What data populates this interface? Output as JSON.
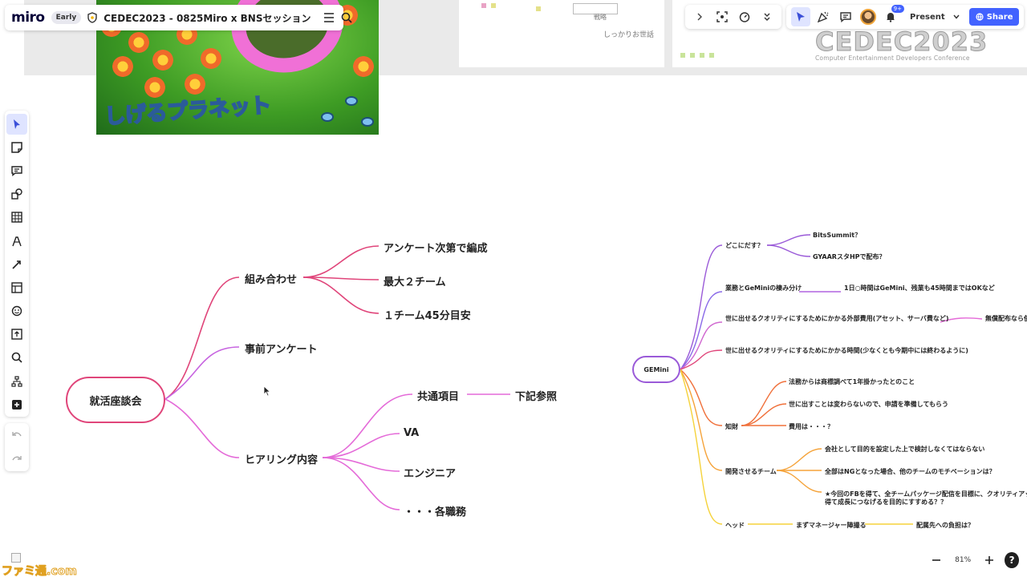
{
  "app": {
    "brand": "miro",
    "badge": "Early",
    "board_title": "CEDEC2023 - 0825Miro x BNSセッション"
  },
  "toolbar_right": {
    "present_label": "Present",
    "share_label": "Share",
    "notification_count": "9+"
  },
  "background_frames": {
    "frame_a_label": "戦略",
    "frame_a_note": "しっかりお世話"
  },
  "cedec_logo": {
    "title": "CEDEC2023",
    "subtitle": "Computer Entertainment Developers Conference"
  },
  "game_image": {
    "logo_text": "しげるプラネット"
  },
  "left_toolbar": {
    "tools": [
      "select-icon",
      "sticky-note-icon",
      "comment-icon",
      "shapes-icon",
      "table-icon",
      "pen-icon",
      "connector-icon",
      "frame-icon",
      "emoji-icon",
      "upload-icon",
      "search-icon",
      "mindmap-icon",
      "add-icon"
    ]
  },
  "mindmap_left": {
    "root": "就活座談会",
    "branches": {
      "b1": "組み合わせ",
      "b1_children": [
        "アンケート次第で編成",
        "最大２チーム",
        "１チーム45分目安"
      ],
      "b2": "事前アンケート",
      "b3": "ヒアリング内容",
      "b3_children": [
        "共通項目",
        "VA",
        "エンジニア",
        "・・・各職務"
      ],
      "b3_c1_child": "下記参照"
    }
  },
  "mindmap_right": {
    "root": "GEMini",
    "n1": "どこにだす？",
    "n1_children": [
      "BitsSummit？",
      "GYAARスタHPで配布？"
    ],
    "n2": "業務とGeMiniの棲み分け",
    "n2_child": "1日○時間はGeMini、残業も45時間まではOKなど",
    "n3": "世に出せるクオリティにするためにかかる外部費用(アセット、サーバ費など)",
    "n3_child": "無償配布なら使",
    "n4": "世に出せるクオリティにするためにかかる時間(少なくとも今期中には終わるように)",
    "n5": "知財",
    "n5_children": [
      "法務からは商標調べて1年掛かったとのこと",
      "世に出すことは変わらないので、申請を準備してもらう",
      "費用は・・・？"
    ],
    "n6": "開発させるチーム",
    "n6_children": [
      "会社として目的を設定した上で検討しなくてはならない",
      "全部はNGとなった場合、他のチームのモチベーションは？",
      "★今回のFBを得て、全チームパッケージ配信を目標に、クオリティアップ"
    ],
    "n6_c3_line2": "得て成長につなげるを目的にすすめる？？",
    "n7": "ヘッド",
    "n7_child": "まずマネージャー陣撮る",
    "n7_grandchild": "配属先への負担は？"
  },
  "zoom": {
    "value": "81%"
  },
  "watermark": {
    "text": "ファミ通.com"
  },
  "colors": {
    "accent": "#4262ff",
    "branch_red": "#e0457a",
    "branch_pink": "#e46ad8",
    "branch_purple": "#a064e0",
    "branch_orange": "#f08a3a",
    "branch_yellow": "#f5c53a"
  }
}
